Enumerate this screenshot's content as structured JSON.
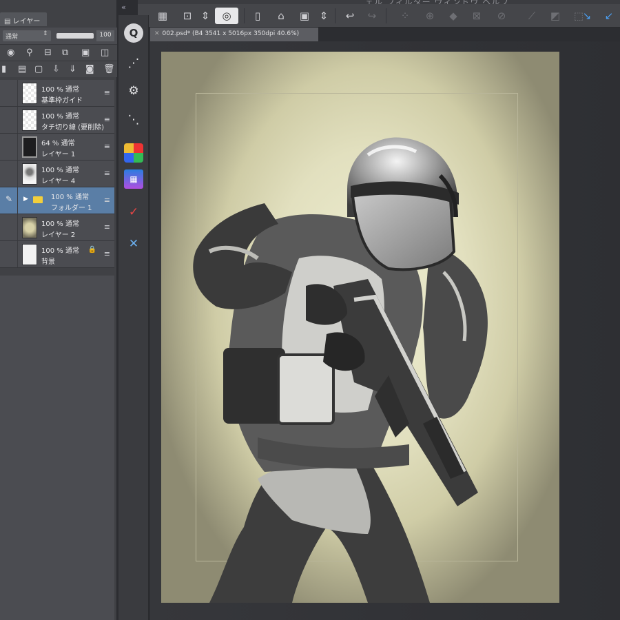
{
  "menu": {
    "partial_text": "ェル  フィルター  ウィンドウ  ヘルプ"
  },
  "layer_panel": {
    "tab_label": "レイヤー",
    "blend_mode": "通常",
    "opacity": "100",
    "layers": [
      {
        "opacity_mode": "100 % 通常",
        "name": "基準枠ガイド",
        "thumb": "checker",
        "selected": false,
        "locked": false,
        "folder": false
      },
      {
        "opacity_mode": "100 % 通常",
        "name": "タチ切り線 (要削除)",
        "thumb": "checker",
        "selected": false,
        "locked": false,
        "folder": false
      },
      {
        "opacity_mode": "64 % 通常",
        "name": "レイヤー 1",
        "thumb": "dark",
        "selected": false,
        "locked": false,
        "folder": false
      },
      {
        "opacity_mode": "100 % 通常",
        "name": "レイヤー 4",
        "thumb": "sketch",
        "selected": false,
        "locked": false,
        "folder": false
      },
      {
        "opacity_mode": "100 % 通常",
        "name": "フォルダー 1",
        "thumb": "none",
        "selected": true,
        "locked": false,
        "folder": true
      },
      {
        "opacity_mode": "100 % 通常",
        "name": "レイヤー 2",
        "thumb": "painted",
        "selected": false,
        "locked": false,
        "folder": false
      },
      {
        "opacity_mode": "100 % 通常",
        "name": "背景",
        "thumb": "white",
        "selected": false,
        "locked": true,
        "folder": false
      }
    ]
  },
  "tool_strip": {
    "icons": [
      "q-search-icon",
      "brush-tool-icon",
      "layer-settings-icon",
      "layer-sync-icon",
      "color-set-icon",
      "animation-icon",
      "red-pen-icon",
      "transform-icon"
    ],
    "search_glyph": "Q"
  },
  "toolbar": {
    "icons": [
      "grid-icon",
      "move-view-icon",
      "spin-icon",
      "lasso-icon",
      "new-file-icon",
      "open-file-icon",
      "save-icon",
      "updown-icon",
      "undo-icon",
      "redo-icon",
      "select-all-icon",
      "transform-icon",
      "fill-icon",
      "mesh-icon",
      "deselect-icon",
      "invert-icon",
      "crop-icon",
      "snap-ruler-icon",
      "snap-grid-icon"
    ]
  },
  "document": {
    "tab_title": "002.psd* (B4 3541 x 5016px 350dpi 40.6%)"
  },
  "colors": {
    "panel_bg": "#4b4c51",
    "selected_layer": "#5a7ea6",
    "folder": "#f2cf3c",
    "paper_light": "#eeeed2",
    "paper_dark": "#8e8b72"
  }
}
